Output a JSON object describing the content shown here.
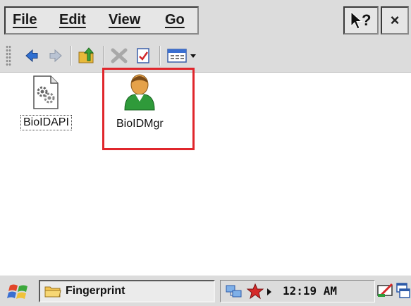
{
  "menu": {
    "file": "File",
    "edit": "Edit",
    "view": "View",
    "go": "Go"
  },
  "titlebar": {
    "help_icon": "help-question-icon",
    "close_label": "×"
  },
  "toolbar": {
    "buttons": [
      "back-arrow-icon",
      "forward-arrow-icon",
      "up-folder-icon",
      "delete-icon",
      "properties-icon",
      "view-menu-icon"
    ]
  },
  "desktop": {
    "items": [
      {
        "label": "BioIDAPI",
        "icon": "dll-file-icon"
      },
      {
        "label": "BioIDMgr",
        "icon": "user-icon"
      }
    ],
    "highlight_color": "#e0262c"
  },
  "taskbar": {
    "task_label": "Fingerprint",
    "clock": "12:19 AM"
  }
}
